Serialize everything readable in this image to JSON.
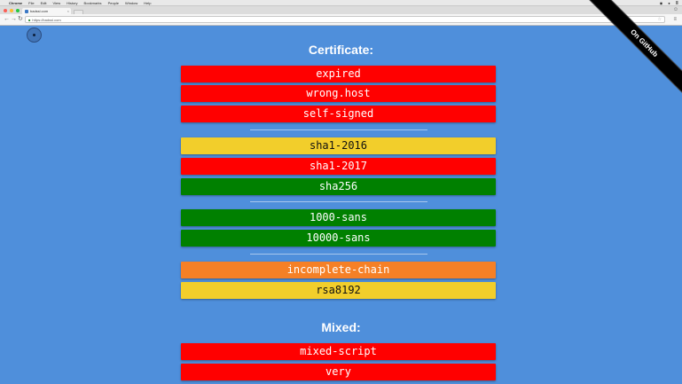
{
  "menubar": {
    "apple": "",
    "items": [
      "Chrome",
      "File",
      "Edit",
      "View",
      "History",
      "Bookmarks",
      "People",
      "Window",
      "Help"
    ],
    "right_icons": [
      "◉",
      "●",
      "≣"
    ]
  },
  "browser": {
    "tab_title": "badssl.com",
    "url": "https://badssl.com",
    "back_icon": "←",
    "forward_icon": "→",
    "reload_icon": "↻",
    "menu_icon": "≡",
    "star_icon": "☆",
    "person_icon": "☺"
  },
  "page": {
    "ribbon": "On GitHub",
    "certificate_heading": "Certificate:",
    "mixed_heading": "Mixed:",
    "certificate_buttons": [
      {
        "label": "expired",
        "color": "#ff0000"
      },
      {
        "label": "wrong.host",
        "color": "#ff0000"
      },
      {
        "label": "self-signed",
        "color": "#ff0000"
      },
      {
        "label": "sha1-2016",
        "color": "#f2ce2b"
      },
      {
        "label": "sha1-2017",
        "color": "#ff0000"
      },
      {
        "label": "sha256",
        "color": "#008000"
      },
      {
        "label": "1000-sans",
        "color": "#008000"
      },
      {
        "label": "10000-sans",
        "color": "#008000"
      },
      {
        "label": "incomplete-chain",
        "color": "#f58026"
      },
      {
        "label": "rsa8192",
        "color": "#f2ce2b"
      }
    ],
    "mixed_buttons": [
      {
        "label": "mixed-script",
        "color": "#ff0000"
      },
      {
        "label": "very",
        "color": "#ff0000"
      }
    ]
  }
}
